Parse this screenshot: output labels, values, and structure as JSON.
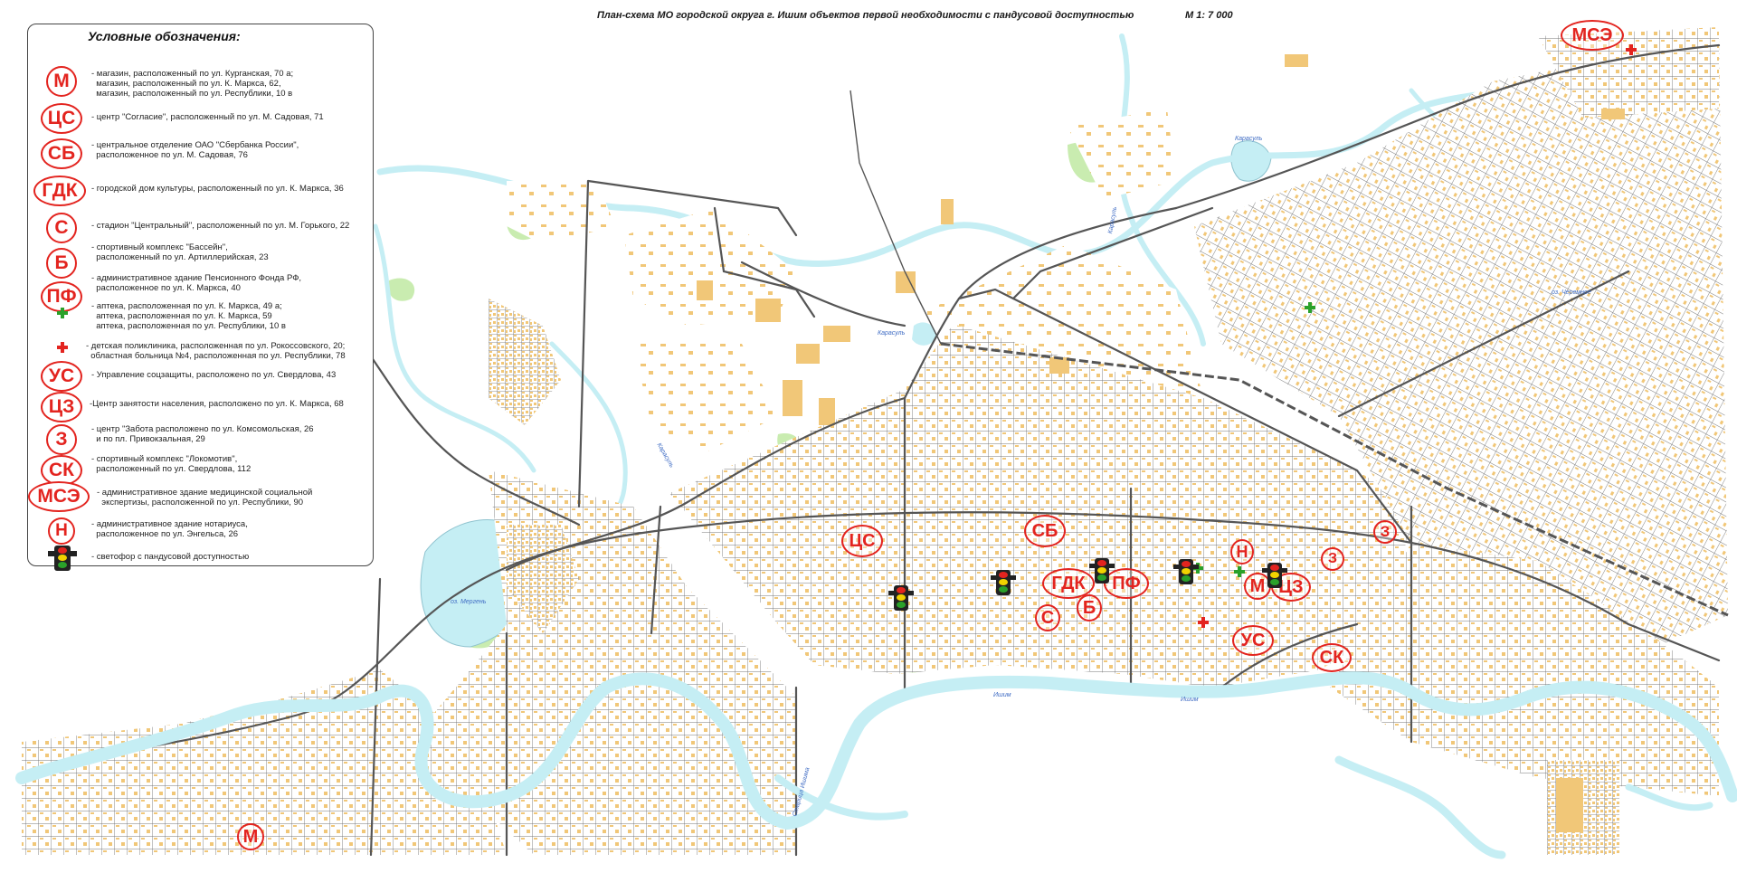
{
  "title": "План-схема МО городской округа г. Ишим объектов первой необходимости с пандусовой доступностью",
  "scale": "М 1: 7 000",
  "legend": {
    "title": "Условные обозначения:",
    "items": [
      {
        "code": "М",
        "text": "- магазин, расположенный по ул. Курганская, 70 а;\n  магазин, расположенный по ул. К. Маркса, 62,\n  магазин, расположенный по ул. Республики, 10 в"
      },
      {
        "code": "ЦС",
        "text": "- центр \"Согласие\", расположенный по ул. М. Садовая, 71"
      },
      {
        "code": "СБ",
        "text": "- центральное отделение ОАО \"Сбербанка России\",\n  расположенное по ул. М. Садовая, 76"
      },
      {
        "code": "ГДК",
        "text": "- городской дом культуры, расположенный по ул. К. Маркса, 36"
      },
      {
        "code": "С",
        "text": "- стадион \"Центральный\", расположенный по ул. М. Горького, 22"
      },
      {
        "code": "Б",
        "text": "- спортивный комплекс \"Бассейн\",\n  расположенный по ул. Артиллерийская, 23"
      },
      {
        "code": "ПФ",
        "text": "- административное здание Пенсионного Фонда РФ,\n  расположенное по ул. К. Маркса, 40"
      },
      {
        "code": "pharmacy",
        "text": "- аптека, расположенная по ул. К. Маркса, 49 а;\n  аптека, расположенная по ул. К. Маркса, 59\n  аптека, расположенная по ул. Республики, 10 в"
      },
      {
        "code": "hospital",
        "text": "- детская поликлиника, расположенная по ул. Рокоссовского, 20;\n  областная больница №4, расположенная по ул. Республики, 78"
      },
      {
        "code": "УС",
        "text": "- Управление соцзащиты, расположено по ул. Свердлова, 43"
      },
      {
        "code": "ЦЗ",
        "text": "-Центр занятости населения, расположено по ул. К. Маркса, 68"
      },
      {
        "code": "З",
        "text": "- центр \"Забота расположено по ул. Комсомольская, 26\n  и по пл. Привокзальная, 29"
      },
      {
        "code": "СК",
        "text": "- спортивный комплекс \"Локомотив\",\n  расположенный по ул. Свердлова, 112"
      },
      {
        "code": "МСЭ",
        "text": "- административное здание медицинской социальной\n  экспертизы, расположенной по ул. Республики, 90"
      },
      {
        "code": "Н",
        "text": "- административное здание нотариуса,\n  расположенное по ул. Энгельса, 26"
      },
      {
        "code": "traffic-light",
        "text": "- светофор с пандусовой доступностью"
      }
    ]
  },
  "map_markers": [
    {
      "code": "МСЭ"
    },
    {
      "code": "ЦС"
    },
    {
      "code": "СБ"
    },
    {
      "code": "ГДК"
    },
    {
      "code": "ПФ"
    },
    {
      "code": "Б"
    },
    {
      "code": "С"
    },
    {
      "code": "Н"
    },
    {
      "code": "М"
    },
    {
      "code": "ЦЗ"
    },
    {
      "code": "З"
    },
    {
      "code": "З"
    },
    {
      "code": "УС"
    },
    {
      "code": "СК"
    },
    {
      "code": "М"
    }
  ],
  "place_labels": [
    "оз. Мергень",
    "оз. Черемное",
    "Карасуль",
    "Карасуль",
    "Карасуль",
    "Карасуль",
    "Ишим",
    "Ишим",
    "Старица Ишима"
  ],
  "colors": {
    "marker": "#e3241f",
    "building": "#f1c778",
    "water": "#c5eef4",
    "park": "#c9ecb0",
    "road": "#555555",
    "pharmacy": "#2aa12a",
    "hospital": "#e3241f"
  }
}
